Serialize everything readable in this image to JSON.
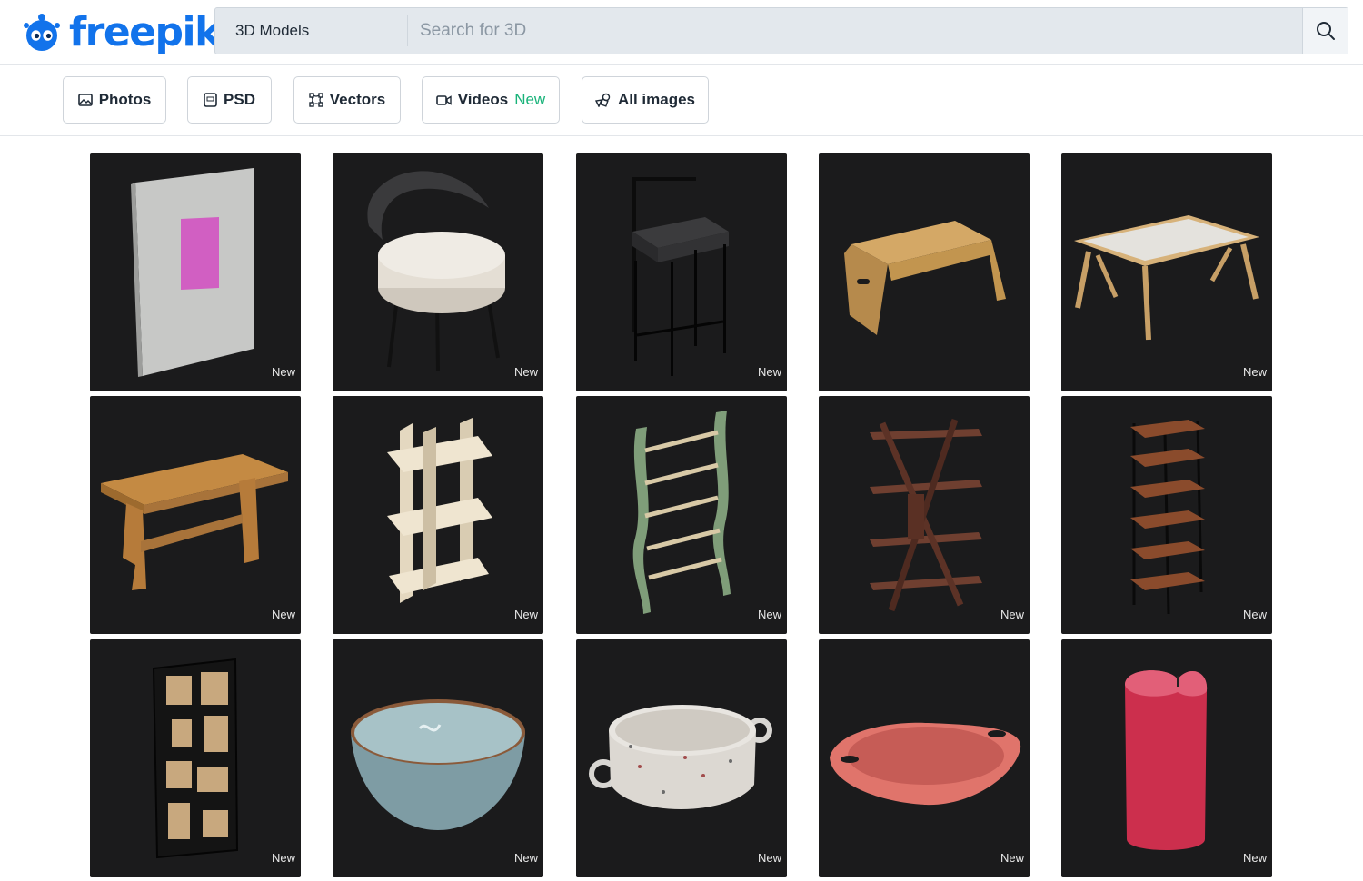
{
  "brand": {
    "name": "freepik",
    "color": "#1273eb"
  },
  "search": {
    "category": "3D Models",
    "placeholder": "Search for 3D",
    "value": "",
    "button_icon": "search-icon"
  },
  "filters": [
    {
      "label": "Photos",
      "icon": "photo-icon"
    },
    {
      "label": "PSD",
      "icon": "psd-icon"
    },
    {
      "label": "Vectors",
      "icon": "vector-icon"
    },
    {
      "label": "Videos",
      "icon": "video-icon",
      "tag": "New"
    },
    {
      "label": "All images",
      "icon": "shapes-icon"
    }
  ],
  "colors": {
    "accent_new": "#19b37a",
    "card_bg": "#1b1b1c"
  },
  "grid": {
    "items": [
      {
        "subject": "canvas-frame",
        "badge": "New"
      },
      {
        "subject": "round-chair",
        "badge": "New"
      },
      {
        "subject": "bar-stool",
        "badge": "New"
      },
      {
        "subject": "wooden-bench",
        "badge": ""
      },
      {
        "subject": "bed-tray-table",
        "badge": "New"
      },
      {
        "subject": "wooden-table",
        "badge": "New"
      },
      {
        "subject": "plywood-shelf",
        "badge": "New"
      },
      {
        "subject": "green-ladder-shelf",
        "badge": "New"
      },
      {
        "subject": "x-bookshelf",
        "badge": "New"
      },
      {
        "subject": "metal-wood-shelf",
        "badge": "New"
      },
      {
        "subject": "cube-bookcase",
        "badge": "New"
      },
      {
        "subject": "ceramic-bowl",
        "badge": "New"
      },
      {
        "subject": "terrazzo-pot",
        "badge": "New"
      },
      {
        "subject": "pink-tray-bowl",
        "badge": "New"
      },
      {
        "subject": "heart-candle",
        "badge": "New"
      }
    ]
  }
}
